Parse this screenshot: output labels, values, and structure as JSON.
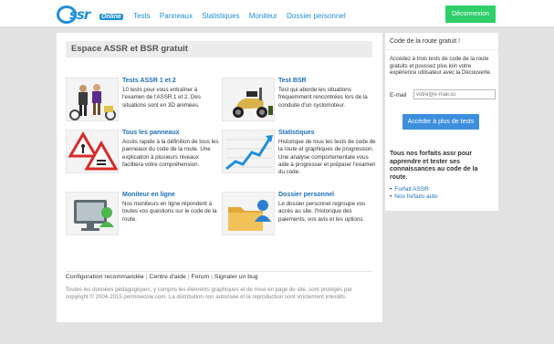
{
  "header": {
    "logo_text": "ssr",
    "logo_sub": "Online",
    "nav": [
      "Tests",
      "Panneaux",
      "Statistiques",
      "Moniteur",
      "Dossier personnel"
    ],
    "logout_label": "Déconnexion"
  },
  "main": {
    "title": "Espace ASSR et BSR gratuit",
    "features": [
      {
        "title": "Tests ASSR 1 et 2",
        "desc": "10 tests pour vous entraîner à l'examen de l'ASSR 1 et 2. Des situations sont en 3D animées.",
        "icon": "students-scooter-image"
      },
      {
        "title": "Test BSR",
        "desc": "Test qui aborde les situations fréquemment rencontrées lors de la conduite d'un cyclomoteur.",
        "icon": "scooter-image"
      },
      {
        "title": "Tous les panneaux",
        "desc": "Accès rapide à la définition de tous les panneaux du code de la route. Une explication à plusieurs niveaux facilitera votre compréhension.",
        "icon": "road-signs-image"
      },
      {
        "title": "Statistiques",
        "desc": "Historique de tous les tests de code de la route et graphiques de progression. Une analyse comportementale vous aide à progresser et préparer l'examen du code.",
        "icon": "chart-image"
      },
      {
        "title": "Moniteur en ligne",
        "desc": "Nos moniteurs en ligne répondent à toutes vos questions sur le code de la route.",
        "icon": "monitor-chat-image"
      },
      {
        "title": "Dossier personnel",
        "desc": "Le dossier personnel regroupe vos accès au site, l'historique des paiements, vos avis et les options.",
        "icon": "folder-user-image"
      }
    ],
    "footer_links": [
      "Configuration recommandée",
      "Centre d'aide",
      "Forum",
      "Signaler un bug"
    ],
    "copyright": "Toutes les données pédagogiques, y compris les éléments graphiques et de mise en page du site, sont protégés par copyright © 2004-2015 permisecole.com. La distribution non autorisée et la reproduction sont strictement interdits."
  },
  "sidebar": {
    "title": "Code de la route gratuit !",
    "text": "Accédez à trois tests de code de la route gratuits et poussez plus loin votre expérience utilisateur avec la Découverte.",
    "email_label": "E-mail",
    "email_placeholder": "votre@e-mail.ici",
    "button_label": "Accéder à plus de tests",
    "promo": "Tous nos forfaits assr pour apprendre et tester ses connaissances au code de la route.",
    "links": [
      "Forfait ASSR",
      "Nos forfaits auto"
    ]
  },
  "colors": {
    "accent": "#1e8fd8",
    "logout": "#2fcf6b",
    "button": "#3d8fde"
  }
}
